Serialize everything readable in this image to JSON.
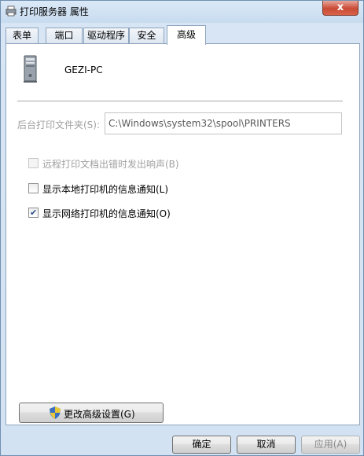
{
  "window": {
    "title": "打印服务器 属性",
    "close_label": "x"
  },
  "tabs": [
    {
      "label": "表单",
      "active": false
    },
    {
      "label": "端口",
      "active": false
    },
    {
      "label": "驱动程序",
      "active": false
    },
    {
      "label": "安全",
      "active": false
    },
    {
      "label": "高级",
      "active": true
    }
  ],
  "server": {
    "name": "GEZI-PC",
    "icon": "computer-tower-icon"
  },
  "spool": {
    "label": "后台打印文件夹(S):",
    "value": "C:\\Windows\\system32\\spool\\PRINTERS"
  },
  "options": [
    {
      "label": "远程打印文档出错时发出响声(B)",
      "checked": false,
      "enabled": false
    },
    {
      "label": "显示本地打印机的信息通知(L)",
      "checked": false,
      "enabled": true
    },
    {
      "label": "显示网络打印机的信息通知(O)",
      "checked": true,
      "enabled": true
    }
  ],
  "advanced_button": {
    "label": "更改高级设置(G)",
    "icon": "uac-shield-icon"
  },
  "footer": {
    "ok_label": "确定",
    "cancel_label": "取消",
    "apply_label": "应用(A)"
  }
}
